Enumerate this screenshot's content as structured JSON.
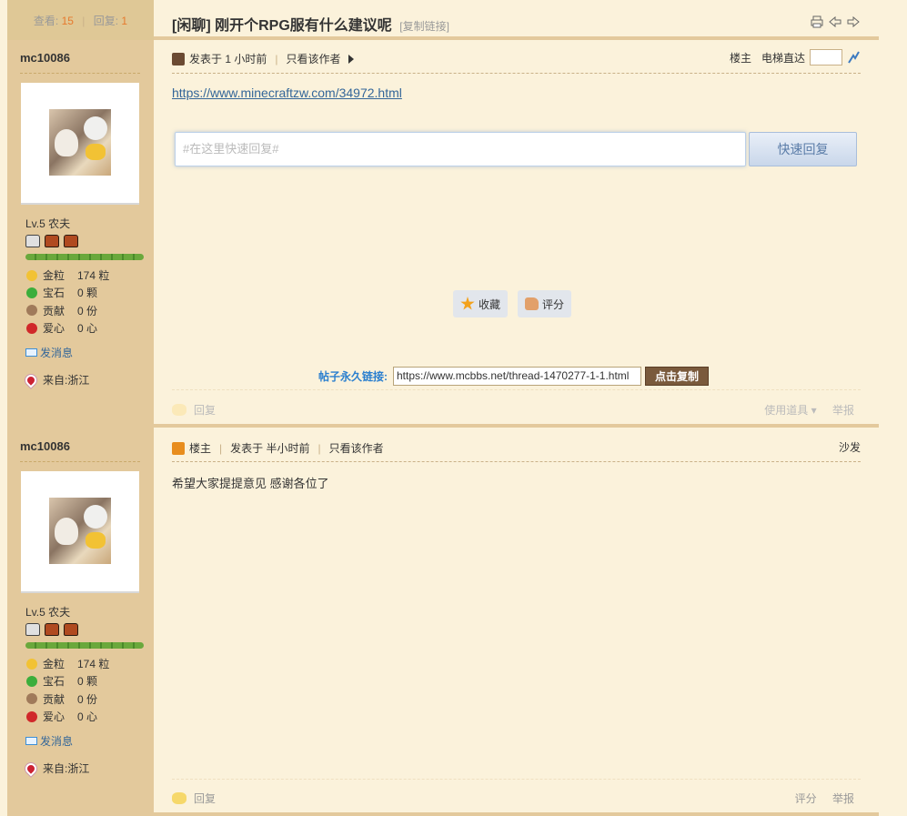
{
  "header": {
    "views_label": "查看:",
    "views": "15",
    "replies_label": "回复:",
    "replies": "1",
    "title": "[闲聊] 刚开个RPG服有什么建议呢",
    "copy_link": "[复制链接]"
  },
  "posts": [
    {
      "author": {
        "name": "mc10086",
        "level": "Lv.5 农夫",
        "stats": [
          {
            "label": "金粒",
            "value": "174 粒",
            "color": "#f2c234"
          },
          {
            "label": "宝石",
            "value": "0 颗",
            "color": "#3cae3c"
          },
          {
            "label": "贡献",
            "value": "0 份",
            "color": "#a07a5a"
          },
          {
            "label": "爱心",
            "value": "0 心",
            "color": "#d0282a"
          }
        ],
        "send_message": "发消息",
        "from": "来自:浙江"
      },
      "meta": {
        "posted": "发表于 1 小时前",
        "only_author": "只看该作者",
        "floor": "楼主",
        "jump": "电梯直达"
      },
      "link_text": "https://www.minecraftzw.com/34972.html",
      "quick_reply": {
        "placeholder": "#在这里快速回复#",
        "button": "快速回复"
      },
      "actions": {
        "favorite": "收藏",
        "rate": "评分"
      },
      "permalink": {
        "label": "帖子永久链接:",
        "url": "https://www.mcbbs.net/thread-1470277-1-1.html",
        "copy": "点击复制"
      },
      "footer": {
        "reply": "回复",
        "tools": "使用道具 ▾",
        "report": "举报"
      }
    },
    {
      "author": {
        "name": "mc10086",
        "level": "Lv.5 农夫",
        "stats": [
          {
            "label": "金粒",
            "value": "174 粒",
            "color": "#f2c234"
          },
          {
            "label": "宝石",
            "value": "0 颗",
            "color": "#3cae3c"
          },
          {
            "label": "贡献",
            "value": "0 份",
            "color": "#a07a5a"
          },
          {
            "label": "爱心",
            "value": "0 心",
            "color": "#d0282a"
          }
        ],
        "send_message": "发消息",
        "from": "来自:浙江"
      },
      "meta": {
        "badge": "楼主",
        "posted": "发表于 半小时前",
        "only_author": "只看该作者",
        "floor": "沙发"
      },
      "content": "希望大家提提意见 感谢各位了",
      "footer": {
        "reply": "回复",
        "rate": "评分",
        "report": "举报"
      }
    }
  ]
}
